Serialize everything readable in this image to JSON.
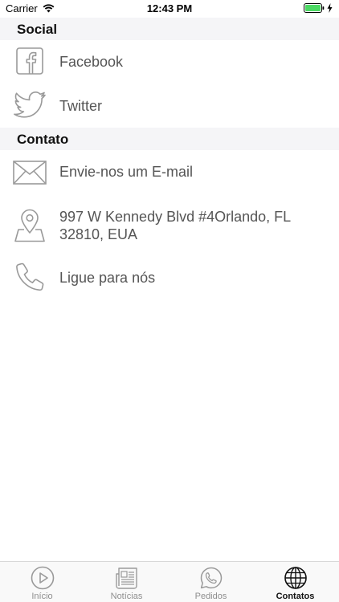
{
  "status_bar": {
    "carrier": "Carrier",
    "time": "12:43 PM"
  },
  "sections": [
    {
      "title": "Social"
    },
    {
      "title": "Contato"
    }
  ],
  "social": {
    "facebook_label": "Facebook",
    "twitter_label": "Twitter"
  },
  "contact": {
    "email_label": "Envie-nos um E-mail",
    "address_line1": "997 W Kennedy Blvd #4Orlando, FL",
    "address_line2": "32810, EUA",
    "phone_label": "Ligue para nós"
  },
  "tabs": [
    {
      "label": "Início",
      "icon": "play-icon",
      "active": false
    },
    {
      "label": "Notícias",
      "icon": "newspaper-icon",
      "active": false
    },
    {
      "label": "Pedidos",
      "icon": "whatsapp-icon",
      "active": false
    },
    {
      "label": "Contatos",
      "icon": "globe-icon",
      "active": true
    }
  ],
  "colors": {
    "icon_gray": "#9a9a9a",
    "active_tab": "#111111",
    "inactive_tab": "#8e8e8e",
    "battery_green": "#4cd964",
    "section_bg": "#f5f5f7"
  }
}
